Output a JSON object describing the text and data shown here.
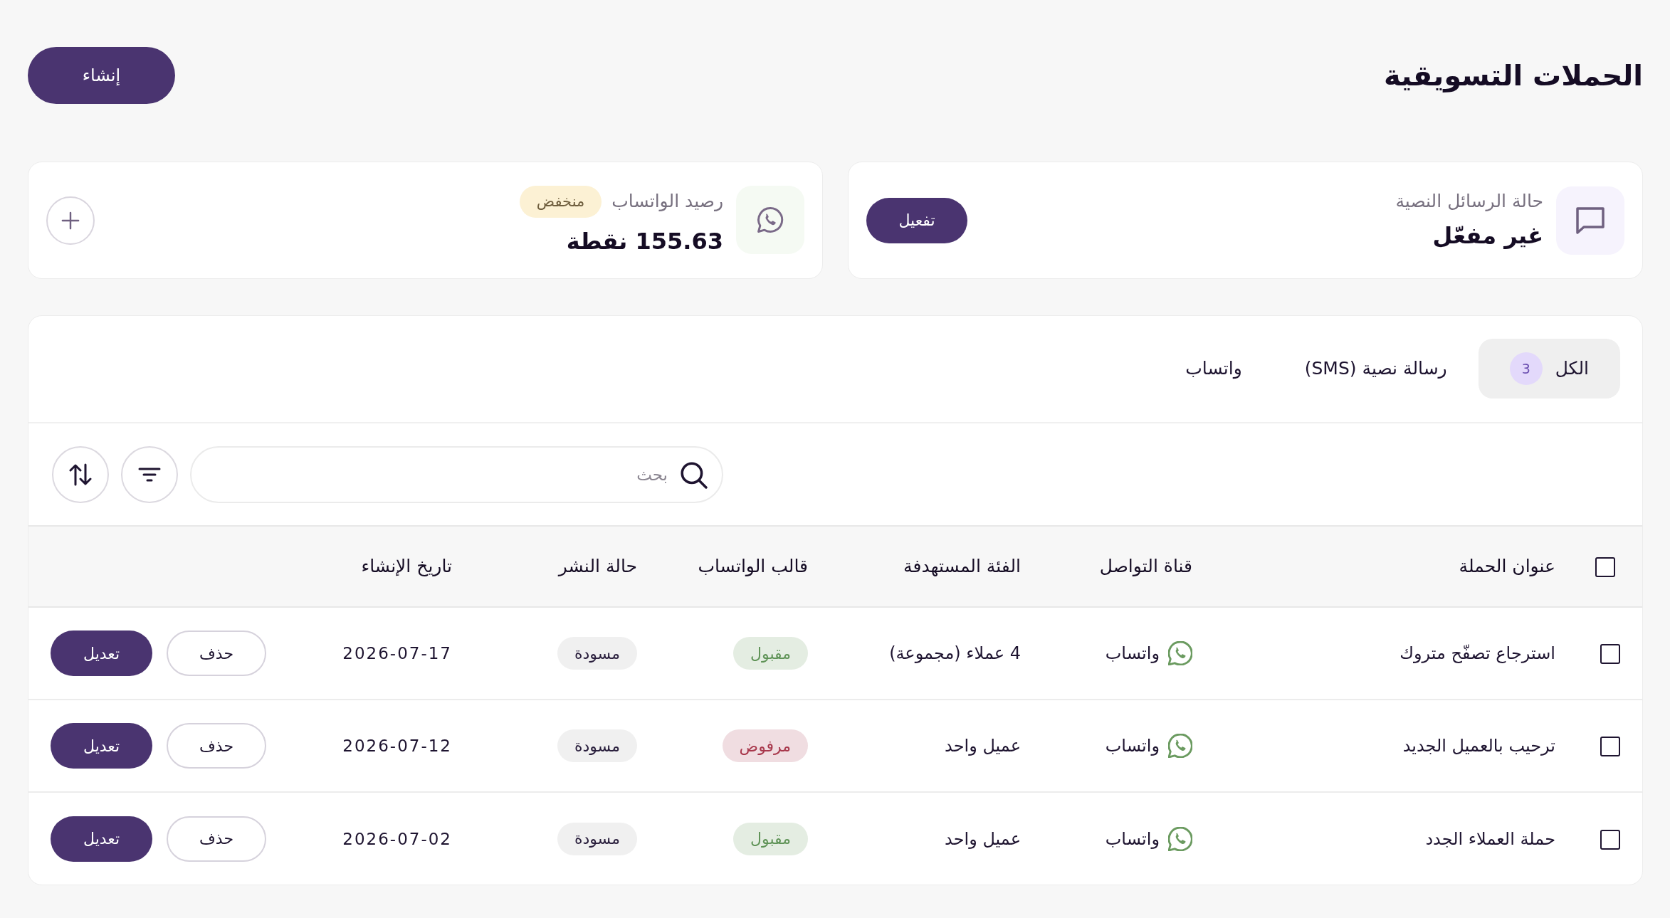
{
  "header": {
    "title": "الحملات التسويقية",
    "create_button": "إنشاء"
  },
  "stat_cards": [
    {
      "kind": "sms",
      "label": "حالة الرسائل النصية",
      "value": "غير مفعّل",
      "action": {
        "kind": "button",
        "label": "تفعيل"
      }
    },
    {
      "kind": "whatsapp",
      "label": "رصيد الواتساب",
      "badge": "منخفض",
      "value": "155.63 نقطة",
      "action": {
        "kind": "add"
      }
    }
  ],
  "tabs": [
    {
      "label": "الكل",
      "count": "3",
      "selected": true
    },
    {
      "label": "رسالة نصية (SMS)",
      "selected": false
    },
    {
      "label": "واتساب",
      "selected": false
    }
  ],
  "search": {
    "placeholder": "بحث"
  },
  "table": {
    "select_all": {
      "checked": false
    },
    "columns": [
      "عنوان الحملة",
      "قناة التواصل",
      "الفئة المستهدفة",
      "قالب الواتساب",
      "حالة النشر",
      "تاريخ الإنشاء"
    ],
    "rows": [
      {
        "checked": false,
        "title": "استرجاع تصفّح متروك",
        "channel": {
          "kind": "whatsapp",
          "label": "واتساب"
        },
        "audience": "4 عملاء (مجموعة)",
        "template_status": {
          "label": "مقبول",
          "color": "#5f9357"
        },
        "publish_status": "مسودة",
        "created": "2026-07-17",
        "actions": [
          {
            "kind": "delete",
            "label": "حذف"
          },
          {
            "kind": "edit",
            "label": "تعديل"
          }
        ]
      },
      {
        "checked": false,
        "title": "ترحيب بالعميل الجديد",
        "channel": {
          "kind": "whatsapp",
          "label": "واتساب"
        },
        "audience": "عميل واحد",
        "template_status": {
          "label": "مرفوض",
          "color": "#a8384c"
        },
        "publish_status": "مسودة",
        "created": "2026-07-12",
        "actions": [
          {
            "kind": "delete",
            "label": "حذف"
          },
          {
            "kind": "edit",
            "label": "تعديل"
          }
        ]
      },
      {
        "checked": false,
        "title": "حملة العملاء الجدد",
        "channel": {
          "kind": "whatsapp",
          "label": "واتساب"
        },
        "audience": "عميل واحد",
        "template_status": {
          "label": "مقبول",
          "color": "#5f9357"
        },
        "publish_status": "مسودة",
        "created": "2026-07-02",
        "actions": [
          {
            "kind": "delete",
            "label": "حذف"
          },
          {
            "kind": "edit",
            "label": "تعديل"
          }
        ]
      }
    ]
  }
}
